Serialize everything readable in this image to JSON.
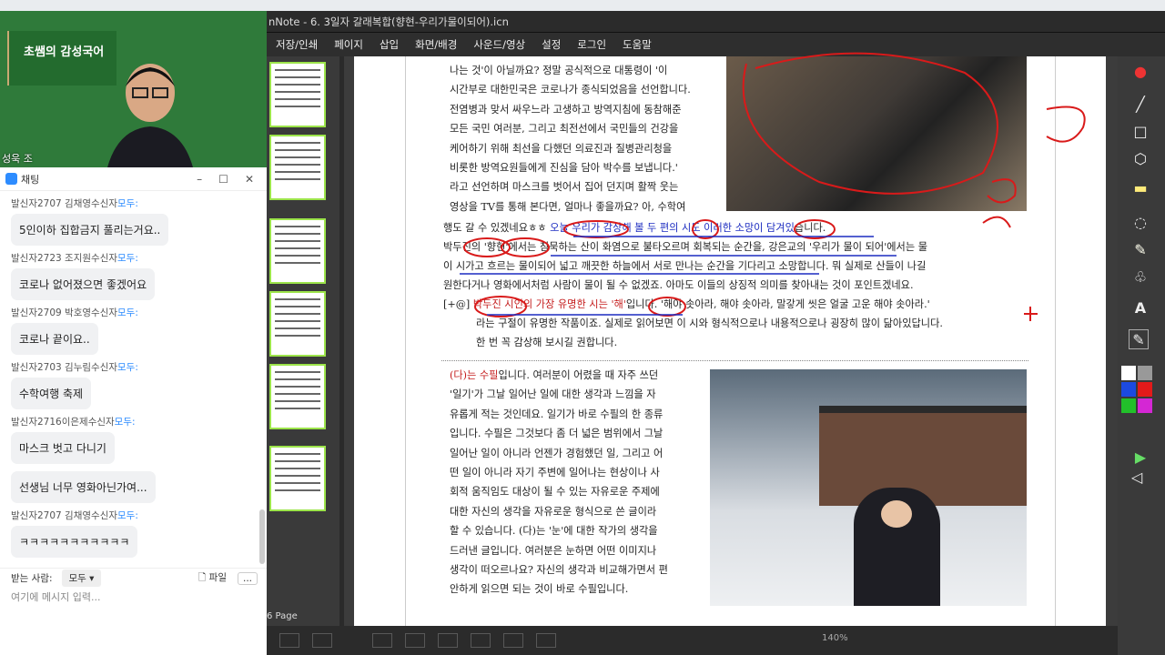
{
  "webcam": {
    "title": "초쌤의 감성국어",
    "name": "성욱 조"
  },
  "chat": {
    "header_title": "채팅",
    "messages": [
      {
        "sender": "발신자2707 김채영",
        "to": "수신자",
        "to_target": "모두:",
        "text": "5인이하 집합금지 풀리는거요.."
      },
      {
        "sender": "발신자2723 조지원",
        "to": "수신자",
        "to_target": "모두:",
        "text": "코로나 없어졌으면 좋겠어요"
      },
      {
        "sender": "발신자2709 박호영",
        "to": "수신자",
        "to_target": "모두:",
        "text": "코로나 끝이요.."
      },
      {
        "sender": "발신자2703 김누림",
        "to": "수신자",
        "to_target": "모두:",
        "text": "수학여행 축제"
      },
      {
        "sender": "발신자2716이은제",
        "to": "수신자",
        "to_target": "모두:",
        "text": "마스크 벗고 다니기"
      },
      {
        "sender": "",
        "to": "",
        "to_target": "",
        "text": "선생님 너무 영화아닌가여..."
      },
      {
        "sender": "발신자2707 김채영",
        "to": "수신자",
        "to_target": "모두:",
        "text": "ㅋㅋㅋㅋㅋㅋㅋㅋㅋㅋㅋ"
      }
    ],
    "recipient_label": "받는 사람:",
    "recipient_value": "모두",
    "file_label": "파일",
    "more_label": "...",
    "input_placeholder": "여기에 메시지 입력..."
  },
  "app": {
    "title": "nNote - 6. 3일자 갈래복합(향현-우리가물이되어).icn"
  },
  "menu": [
    "저장/인쇄",
    "페이지",
    "삽입",
    "화면/배경",
    "사운드/영상",
    "설정",
    "로그인",
    "도움말"
  ],
  "thumbs": {
    "page_count": "6 Page"
  },
  "doc": {
    "para1": [
      "나는 것'이 아닐까요? 정말 공식적으로 대통령이 '이",
      "시간부로 대한민국은 코로나가 종식되었음을 선언합니다.",
      "전염병과 맞서 싸우느라 고생하고 방역지침에 동참해준",
      "모든 국민 여러분, 그리고 최전선에서 국민들의 건강을",
      "케어하기 위해 최선을 다했던 의료진과 질병관리청을",
      "비롯한 방역요원들에게 진심을 담아 박수를 보냅니다.'",
      "라고 선언하며 마스크를 벗어서 집어 던지며 활짝 웃는",
      "영상을 TV를 통해 본다면, 얼마나 좋을까요? 아, 수학여"
    ],
    "line_a": "행도 갈 수 있겠네요ㅎㅎ ",
    "line_a_blue": "오늘 우리가 감상해 볼 두 편의 시도 이러한 소망이 담겨있",
    "line_a_end": "습니다.",
    "line_b": "박두진의 '향현'에서는 침묵하는 산이 화염으로 불타오르며 회복되는 순간을, 강은교의 '우리가 물이 되어'에서는 물",
    "line_c": "이 시가고 흐르는 물이되어 넓고 깨끗한 하늘에서 서로 만나는 순간을 기다리고 소망합니다. 뭐 실제로 산들이 나길",
    "line_d": "원한다거나 영화에서처럼 사람이 물이 될 수 없겠죠. 아마도 이들의 상징적 의미를 찾아내는 것이 포인트겠네요.",
    "tip_prefix": "[+@]",
    "tip_red": "박두진 시인의 가장 유명한 시는 '해'",
    "tip_rest": "입니다. '해야 솟아라, 해야 솟아라, 말갛게 씻은 얼굴 고운 해야 솟아라.'",
    "tip_line2": "라는 구절이 유명한 작품이죠. 실제로 읽어보면 이 시와 형식적으로나 내용적으로나 굉장히 많이 닮아있답니다.",
    "tip_line3": "한 번 꼭 감상해 보시길 권합니다.",
    "para2_red": "(다)는 수필",
    "para2": [
      "입니다. 여러분이 어렸을 때 자주 쓰던",
      "'일기'가 그날 일어난 일에 대한 생각과 느낌을 자",
      "유롭게 적는 것인데요. 일기가 바로 수필의 한 종류",
      "입니다. 수필은 그것보다 좀 더 넓은 범위에서 그날",
      "일어난 일이 아니라 언젠가 경험했던 일, 그리고 어",
      "떤 일이 아니라 자기 주변에 일어나는 현상이나 사",
      "회적 움직임도 대상이 될 수 있는 자유로운 주제에",
      "대한 자신의 생각을 자유로운 형식으로 쓴 글이라",
      "할 수 있습니다. (다)는 '눈'에 대한 작가의 생각을",
      "드러낸 글입니다. 여러분은 눈하면 어떤 이미지나",
      "생각이 떠오르나요? 자신의 생각과 비교해가면서 편",
      "안하게 읽으면 되는 것이 바로 수필입니다."
    ]
  },
  "bottom": {
    "zoom": "140%"
  },
  "colors": {
    "accent": "#9ce44a",
    "pen_red": "#d91a1a",
    "pen_blue": "#1c2cc0",
    "menubar": "#2e2e2e"
  }
}
